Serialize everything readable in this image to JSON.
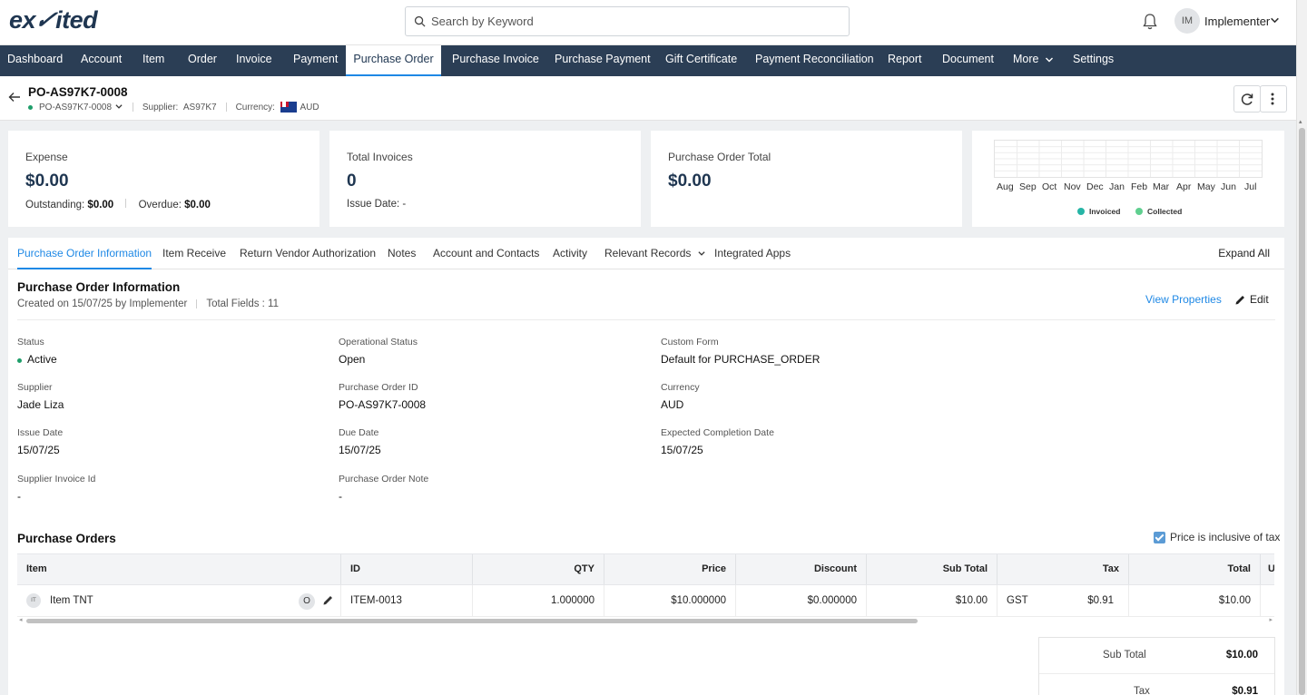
{
  "app": {
    "logo_text": "exited",
    "logo_prefix": "ex",
    "logo_mid": "s",
    "logo_suffix": "ited"
  },
  "search": {
    "placeholder": "Search by Keyword"
  },
  "user": {
    "initials": "IM",
    "name": "Implementer"
  },
  "nav": {
    "items": [
      "Dashboard",
      "Account",
      "Item",
      "Order",
      "Invoice",
      "Payment",
      "Purchase Order",
      "Purchase Invoice",
      "Purchase Payment",
      "Gift Certificate",
      "Payment Reconciliation",
      "Report",
      "Document",
      "More",
      "Settings"
    ],
    "active": "Purchase Order"
  },
  "record": {
    "title": "PO-AS97K7-0008",
    "status_ref": "PO-AS97K7-0008",
    "supplier_label": "Supplier:",
    "supplier_value": "AS97K7",
    "currency_label": "Currency:",
    "currency_value": "AUD"
  },
  "cards": {
    "expense": {
      "label": "Expense",
      "value": "$0.00",
      "outstanding_label": "Outstanding:",
      "outstanding_value": "$0.00",
      "overdue_label": "Overdue:",
      "overdue_value": "$0.00"
    },
    "invoices": {
      "label": "Total Invoices",
      "value": "0",
      "issue_label": "Issue Date:",
      "issue_value": "-"
    },
    "po_total": {
      "label": "Purchase Order Total",
      "value": "$0.00"
    },
    "chart": {
      "months": [
        "Aug",
        "Sep",
        "Oct",
        "Nov",
        "Dec",
        "Jan",
        "Feb",
        "Mar",
        "Apr",
        "May",
        "Jun",
        "Jul"
      ],
      "legend": [
        {
          "name": "Invoiced",
          "color": "#26b5a6"
        },
        {
          "name": "Collected",
          "color": "#5fcf8f"
        }
      ]
    }
  },
  "tabs": {
    "items": [
      "Purchase Order Information",
      "Item Receive",
      "Return Vendor Authorization",
      "Notes",
      "Account and Contacts",
      "Activity",
      "Relevant Records",
      "Integrated Apps"
    ],
    "expand_all": "Expand All"
  },
  "info": {
    "title": "Purchase Order Information",
    "created": "Created on 15/07/25 by Implementer",
    "total_fields": "Total Fields : 11",
    "view_properties": "View Properties",
    "edit": "Edit",
    "fields": {
      "status": {
        "label": "Status",
        "value": "Active"
      },
      "operational_status": {
        "label": "Operational Status",
        "value": "Open"
      },
      "custom_form": {
        "label": "Custom Form",
        "value": "Default for PURCHASE_ORDER"
      },
      "supplier": {
        "label": "Supplier",
        "value": "Jade Liza"
      },
      "po_id": {
        "label": "Purchase Order ID",
        "value": "PO-AS97K7-0008"
      },
      "currency": {
        "label": "Currency",
        "value": "AUD"
      },
      "issue_date": {
        "label": "Issue Date",
        "value": "15/07/25"
      },
      "due_date": {
        "label": "Due Date",
        "value": "15/07/25"
      },
      "expected_completion": {
        "label": "Expected Completion Date",
        "value": "15/07/25"
      },
      "supplier_invoice_id": {
        "label": "Supplier Invoice Id",
        "value": "-"
      },
      "po_note": {
        "label": "Purchase Order Note",
        "value": "-"
      }
    }
  },
  "purchase_orders": {
    "title": "Purchase Orders",
    "price_inclusive_label": "Price is inclusive of tax",
    "price_inclusive_checked": true,
    "columns": [
      "Item",
      "ID",
      "QTY",
      "Price",
      "Discount",
      "Sub Total",
      "Tax",
      "Total",
      "U"
    ],
    "rows": [
      {
        "badge": "IT",
        "item": "Item TNT",
        "o_badge": "O",
        "id": "ITEM-0013",
        "qty": "1.000000",
        "price": "$10.000000",
        "discount": "$0.000000",
        "subtotal": "$10.00",
        "tax_code": "GST",
        "tax": "$0.91",
        "total": "$10.00"
      }
    ],
    "totals": [
      {
        "label": "Sub Total",
        "value": "$10.00"
      },
      {
        "label": "Tax",
        "value": "$0.91"
      }
    ]
  }
}
